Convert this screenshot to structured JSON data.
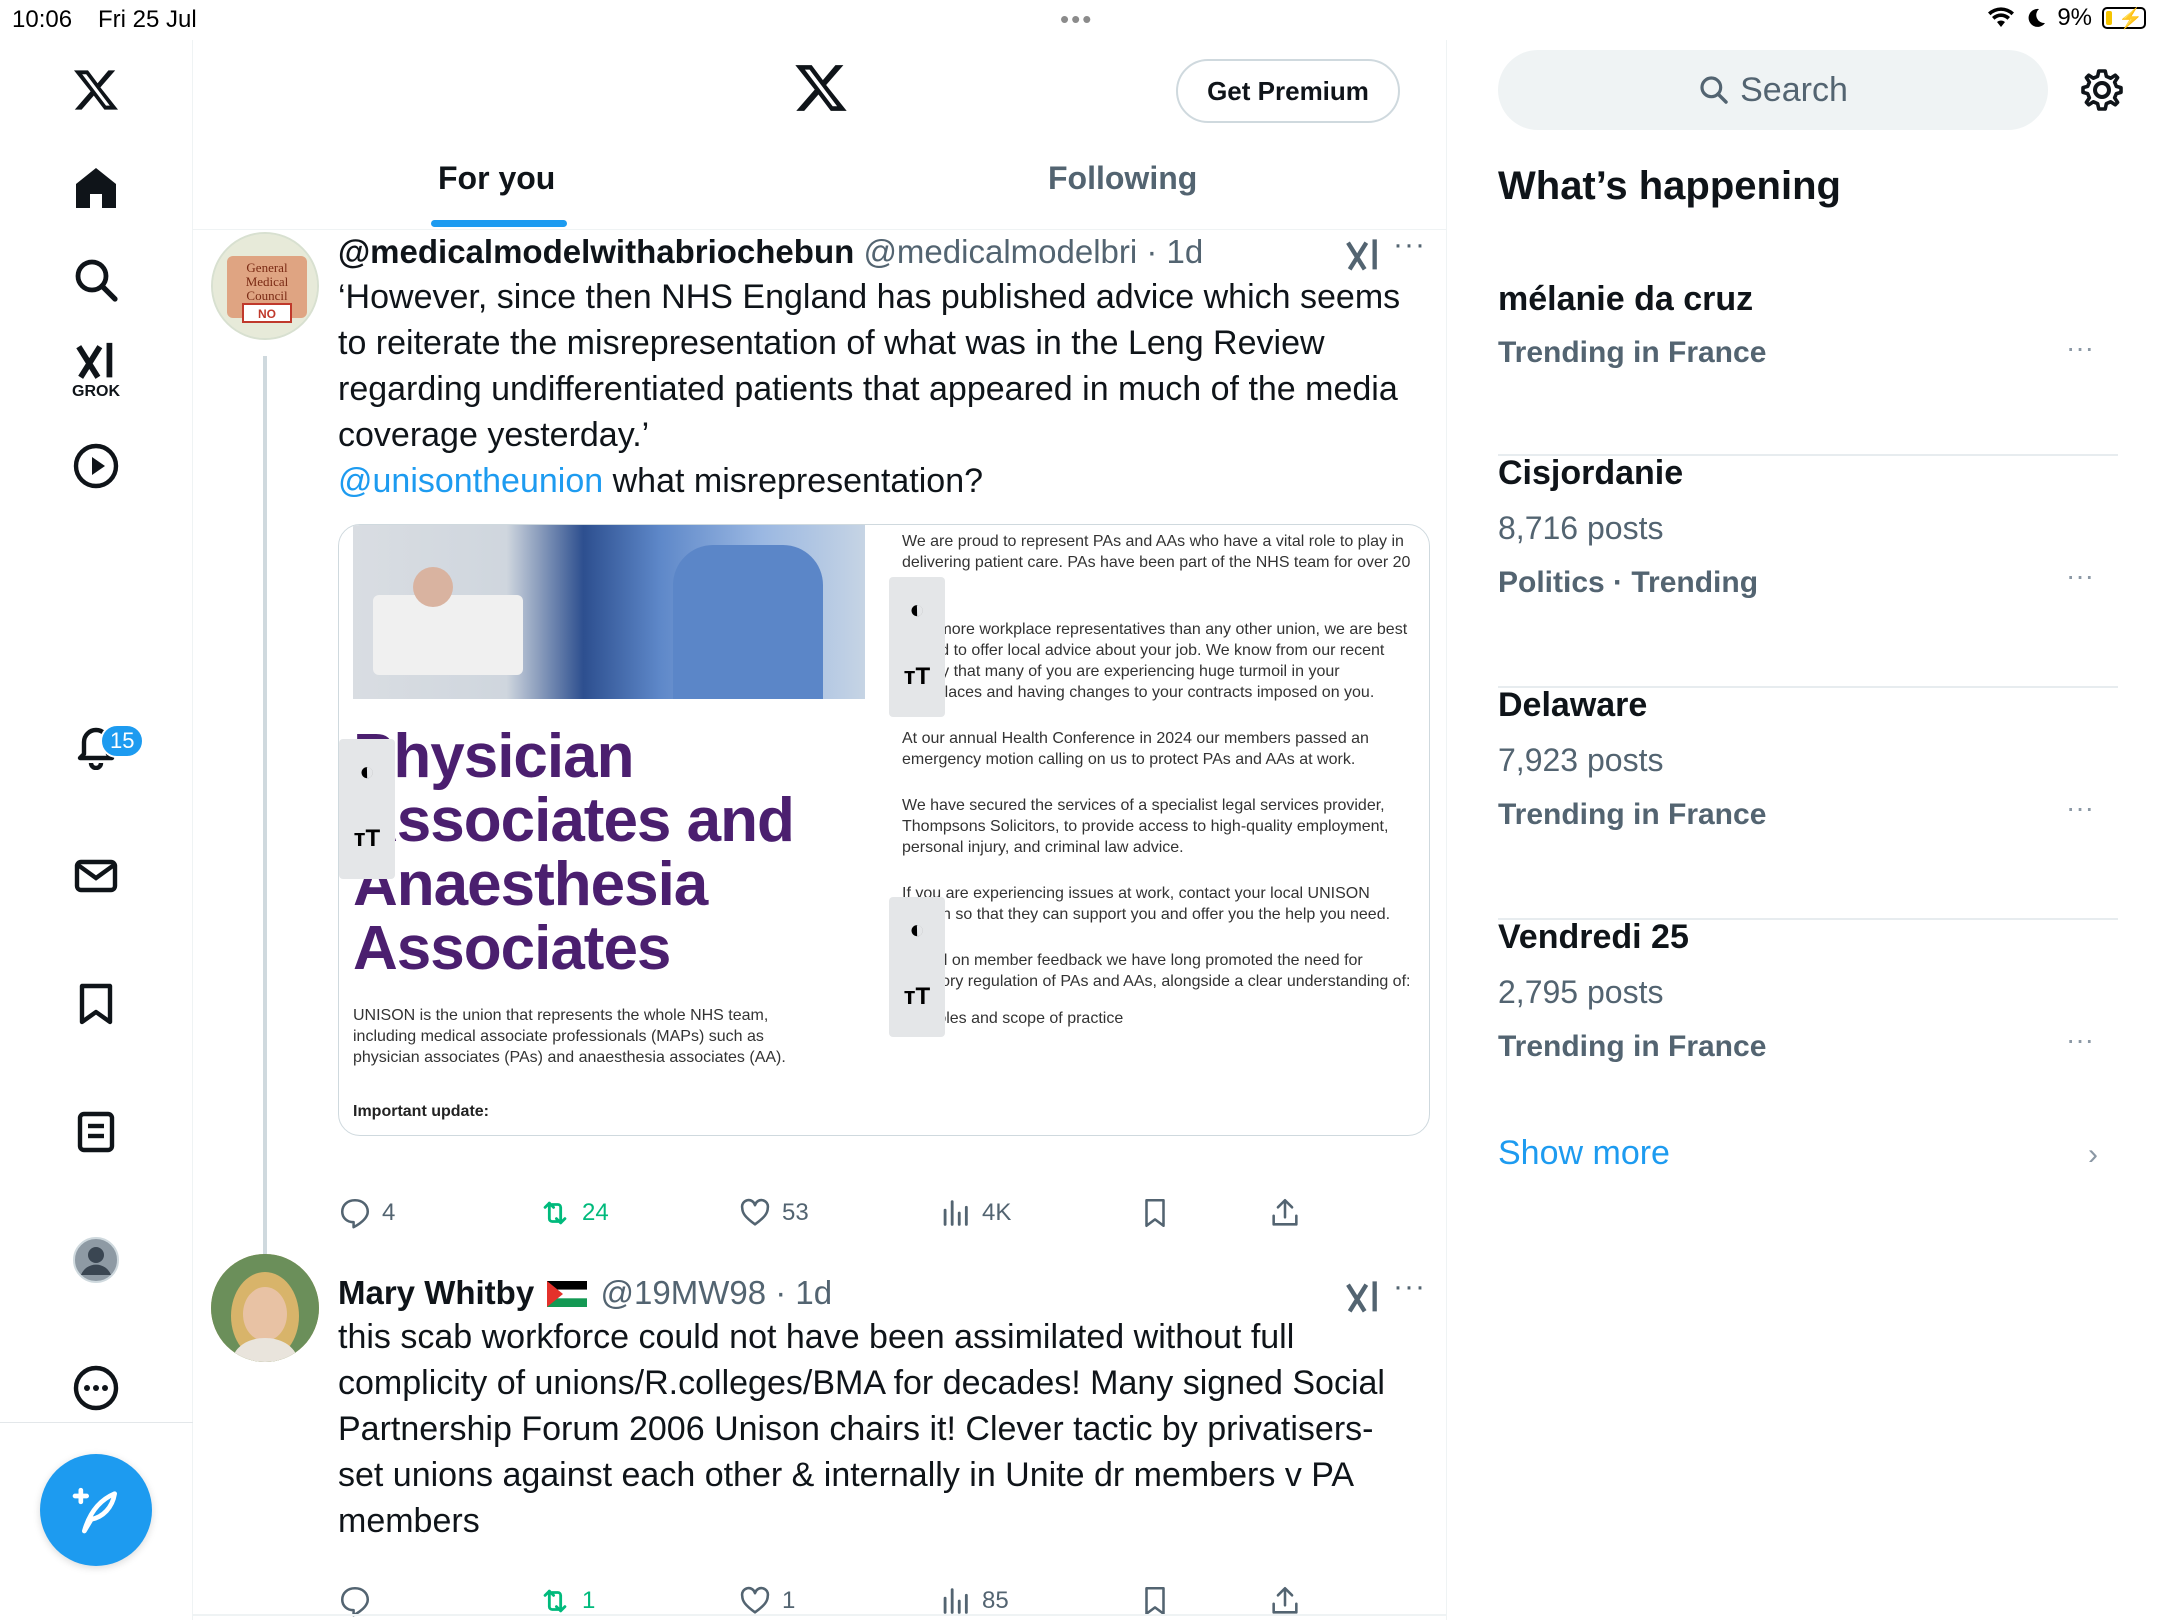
{
  "status_bar": {
    "time": "10:06",
    "date": "Fri 25 Jul",
    "battery": "9%"
  },
  "nav": {
    "items": [
      "home",
      "explore",
      "grok",
      "video",
      "notifications",
      "messages",
      "bookmarks",
      "lists",
      "profile",
      "more"
    ],
    "grok_label": "GROK",
    "notification_count": "15"
  },
  "header": {
    "premium_button": "Get Premium",
    "tabs": [
      {
        "label": "For you",
        "active": true
      },
      {
        "label": "Following",
        "active": false
      }
    ]
  },
  "tweets": [
    {
      "name": "@medicalmodelwithabriochebun",
      "handle": "@medicalmodelbri",
      "time": "1d",
      "text": "‘However, since then NHS England has published advice which seems to reiterate the misrepresentation of what was in the Leng Review regarding undifferentiated patients that appeared in much of the media coverage yesterday.’",
      "mention": "@unisontheunion",
      "text_after_mention": " what misrepresentation?",
      "media": {
        "title_lines": [
          "Physician",
          "Associates and",
          "Anaesthesia",
          "Associates"
        ],
        "intro": "UNISON is the union that represents the whole NHS team, including medical associate professionals (MAPs) such as physician associates (PAs) and anaesthesia associates (AA).",
        "important": "Important update:",
        "paragraphs": [
          "We are proud to represent PAs and AAs who have a vital role to play in delivering patient care. PAs have been part of the NHS team for over 20 years.",
          "With more workplace representatives than any other union, we are best placed to offer local advice about your job. We know from our recent survey that many of you are experiencing huge turmoil in your workplaces and having changes to your contracts imposed on you.",
          "At our annual Health Conference in 2024 our members passed an emergency motion calling on us to protect PAs and AAs at work.",
          "We have secured the services of a specialist legal services provider, Thompsons Solicitors, to provide access to high-quality employment, personal injury, and criminal law advice.",
          "If you are experiencing issues at work, contact your local UNISON branch so that they can support you and offer you the help you need.",
          "Based on member feedback we have long promoted the need for statutory regulation of PAs and AAs, alongside a clear understanding of:"
        ],
        "bullet": "roles and scope of practice"
      },
      "replies": "4",
      "reposts": "24",
      "likes": "53",
      "views": "4K"
    },
    {
      "name": "Mary Whitby",
      "flag": "palestine-flag",
      "handle": "@19MW98",
      "time": "1d",
      "text": "this scab workforce could not have been assimilated without full complicity of unions/R.colleges/BMA for decades! Many signed Social Partnership Forum 2006 Unison chairs it! Clever tactic by privatisers- set unions against each other & internally in Unite dr members v PA members",
      "replies": "",
      "reposts": "1",
      "likes": "1",
      "views": "85"
    }
  ],
  "sidebar": {
    "search_placeholder": "Search",
    "title": "What’s happening",
    "trends": [
      {
        "name": "mélanie da cruz",
        "posts": "",
        "context": "Trending in France"
      },
      {
        "name": "Cisjordanie",
        "posts": "8,716 posts",
        "context": "Politics · Trending"
      },
      {
        "name": "Delaware",
        "posts": "7,923 posts",
        "context": "Trending in France"
      },
      {
        "name": "Vendredi 25",
        "posts": "2,795 posts",
        "context": "Trending in France"
      }
    ],
    "show_more": "Show more"
  },
  "colors": {
    "accent": "#1d9bf0",
    "repost": "#00ba7c",
    "muted": "#536471",
    "unison_purple": "#4b1f6f"
  }
}
